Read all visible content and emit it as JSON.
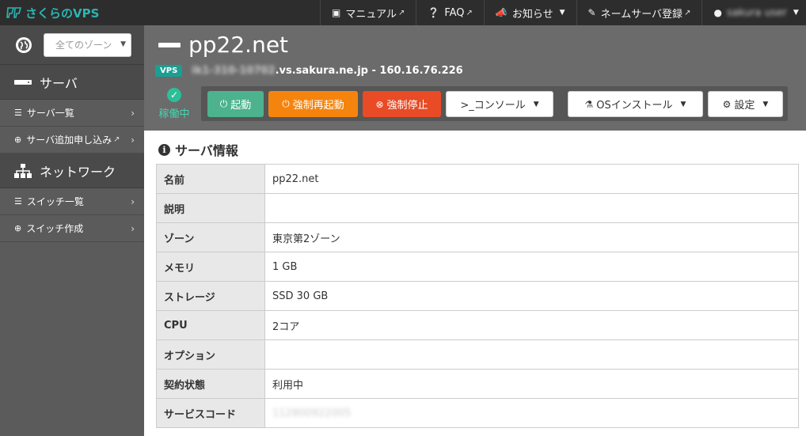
{
  "topnav": {
    "brand": "さくらのVPS",
    "manual": "マニュアル",
    "faq": "FAQ",
    "news": "お知らせ",
    "nameserver": "ネームサーバ登録",
    "user": "sakura user"
  },
  "sidebar": {
    "zone_placeholder": "全てのゾーン",
    "server_section": "サーバ",
    "server_list": "サーバ一覧",
    "server_add": "サーバ追加申し込み",
    "network_section": "ネットワーク",
    "switch_list": "スイッチ一覧",
    "switch_create": "スイッチ作成"
  },
  "header": {
    "title": "pp22.net",
    "badge": "VPS",
    "host_blurred": "ik1-310-10702",
    "host_suffix": ".vs.sakura.ne.jp - 160.16.76.226",
    "status": "稼働中"
  },
  "toolbar": {
    "start": "起動",
    "force_restart": "強制再起動",
    "force_stop": "強制停止",
    "console": ">_コンソール",
    "os_install": "OSインストール",
    "settings": "設定"
  },
  "info": {
    "title": "サーバ情報",
    "rows": [
      {
        "key": "名前",
        "value": "pp22.net"
      },
      {
        "key": "説明",
        "value": ""
      },
      {
        "key": "ゾーン",
        "value": "東京第2ゾーン"
      },
      {
        "key": "メモリ",
        "value": "1 GB"
      },
      {
        "key": "ストレージ",
        "value": "SSD 30 GB"
      },
      {
        "key": "CPU",
        "value": "2コア"
      },
      {
        "key": "オプション",
        "value": ""
      },
      {
        "key": "契約状態",
        "value": "利用中"
      },
      {
        "key": "サービスコード",
        "value": "112800922005"
      }
    ]
  },
  "colors": {
    "nav_bg": "#2d2d2d",
    "sidebar_bg": "#5b5b5b",
    "header_bg": "#6b6b6b",
    "start": "#4cb38e",
    "restart": "#f5840e",
    "stop": "#e84b25",
    "brand": "#2bb5b0"
  }
}
